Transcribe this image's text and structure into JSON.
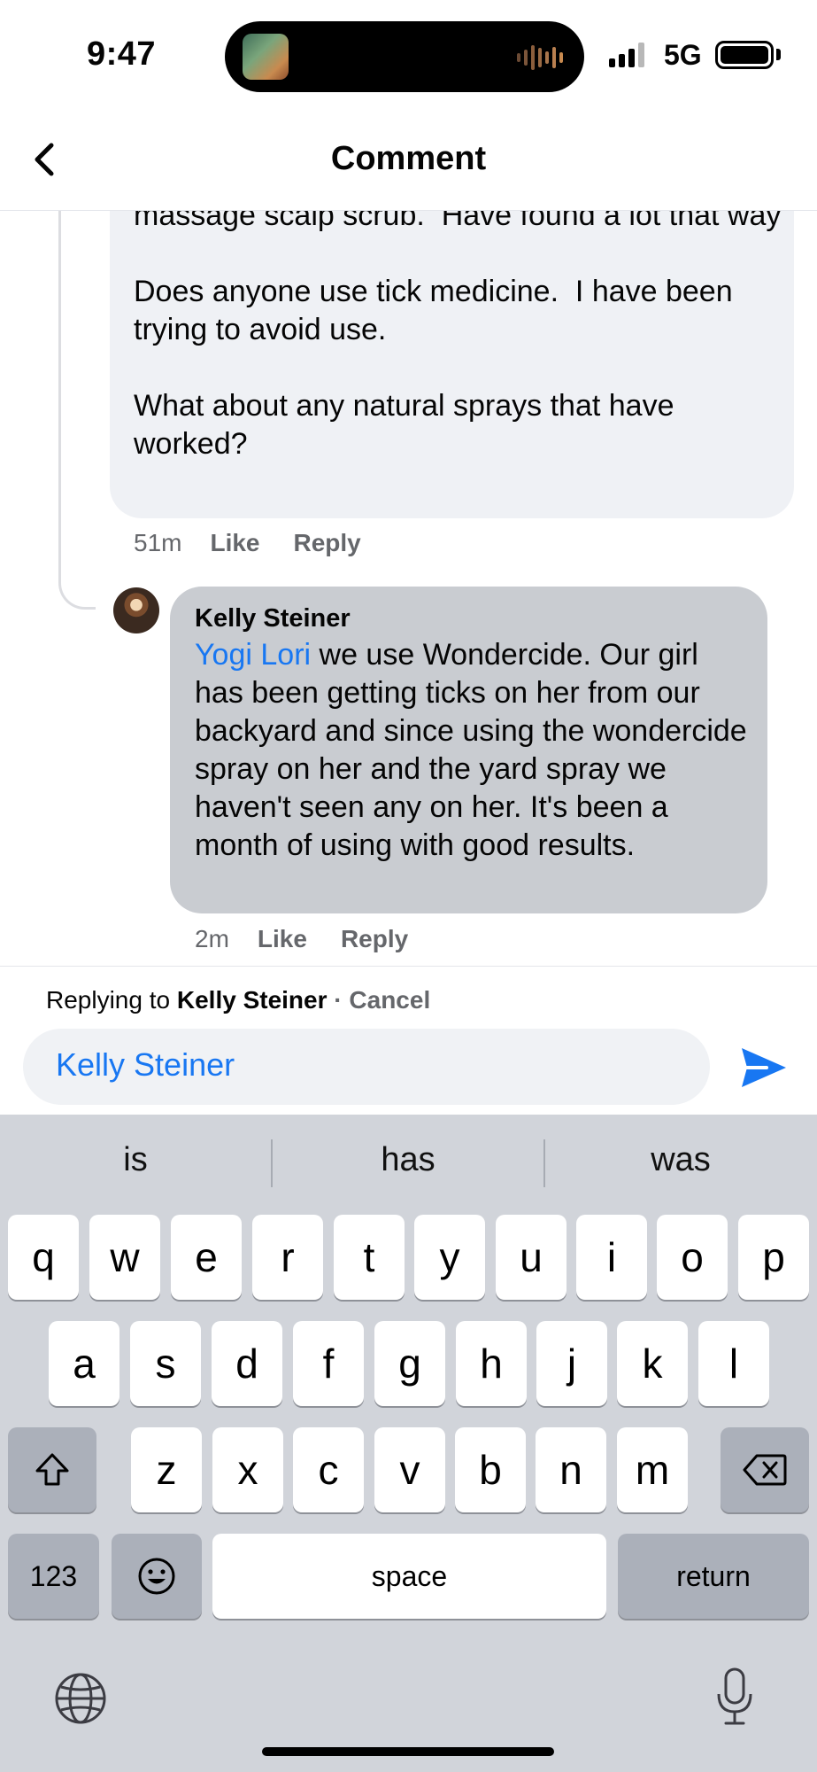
{
  "status_bar": {
    "time": "9:47",
    "network": "5G"
  },
  "header": {
    "title": "Comment"
  },
  "comments": {
    "previous": {
      "text": "massage scalp scrub.  Have found a lot that way\n\nDoes anyone use tick medicine.  I have been trying to avoid use.\n\nWhat about any natural sprays that have worked?",
      "time": "51m",
      "like_label": "Like",
      "reply_label": "Reply"
    },
    "reply": {
      "author": "Kelly Steiner",
      "mention": "Yogi Lori",
      "text": " we use Wondercide. Our girl has been getting ticks on her from our backyard and since using the wondercide spray on her and the yard spray we haven't seen any on her. It's been a month of using with good results.",
      "time": "2m",
      "like_label": "Like",
      "reply_label": "Reply"
    }
  },
  "reply_bar": {
    "prefix": "Replying to ",
    "name": "Kelly Steiner",
    "cancel": " · Cancel",
    "input_value": "Kelly Steiner"
  },
  "keyboard": {
    "suggestions": [
      "is",
      "has",
      "was"
    ],
    "row1": [
      "q",
      "w",
      "e",
      "r",
      "t",
      "y",
      "u",
      "i",
      "o",
      "p"
    ],
    "row2": [
      "a",
      "s",
      "d",
      "f",
      "g",
      "h",
      "j",
      "k",
      "l"
    ],
    "row3": [
      "z",
      "x",
      "c",
      "v",
      "b",
      "n",
      "m"
    ],
    "numbers_label": "123",
    "space_label": "space",
    "return_label": "return"
  },
  "colors": {
    "accent": "#1877f2",
    "bubble_light": "#eff1f5",
    "bubble_dark": "#c9ccd1",
    "keyboard_bg": "#d1d4da"
  }
}
